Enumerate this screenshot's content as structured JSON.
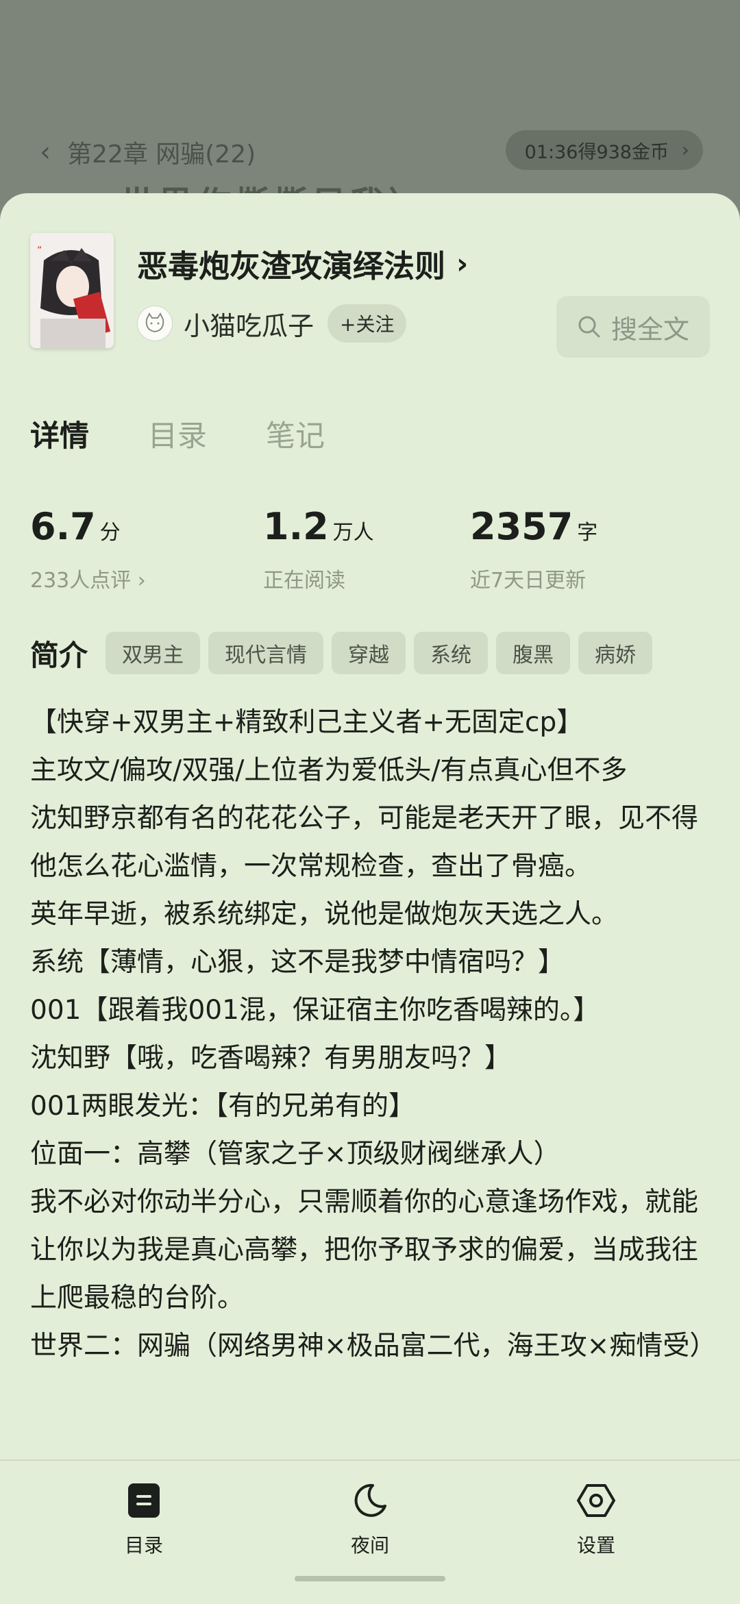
{
  "reader": {
    "chapter_title": "第22章 网骗(22)",
    "coin_pill": "01:36得938金币",
    "ghost_text": "世界作撕撕风我〉"
  },
  "book": {
    "title": "恶毒炮灰渣攻演绎法则",
    "author": "小猫吃瓜子",
    "follow_label": "+关注",
    "search_label": "搜全文"
  },
  "tabs": [
    "详情",
    "目录",
    "笔记"
  ],
  "stats": [
    {
      "num": "6.7",
      "unit": "分",
      "sub": "233人点评 ›"
    },
    {
      "num": "1.2",
      "unit": "万人",
      "sub": "正在阅读"
    },
    {
      "num": "2357",
      "unit": "字",
      "sub": "近7天日更新"
    }
  ],
  "intro": {
    "label": "简介",
    "tags": [
      "双男主",
      "现代言情",
      "穿越",
      "系统",
      "腹黑",
      "病娇"
    ],
    "paragraphs": [
      "【快穿+双男主+精致利己主义者+无固定cp】",
      "主攻文/偏攻/双强/上位者为爱低头/有点真心但不多",
      "沈知野京都有名的花花公子，可能是老天开了眼，见不得他怎么花心滥情，一次常规检查，查出了骨癌。",
      "英年早逝，被系统绑定，说他是做炮灰天选之人。",
      "系统【薄情，心狠，这不是我梦中情宿吗？】",
      "001【跟着我001混，保证宿主你吃香喝辣的。】",
      "沈知野【哦，吃香喝辣？有男朋友吗？】",
      "001两眼发光：【有的兄弟有的】",
      "位面一：高攀（管家之子×顶级财阀继承人）",
      "我不必对你动半分心，只需顺着你的心意逢场作戏，就能让你以为我是真心高攀，把你予取予求的偏爱，当成我往上爬最稳的台阶。",
      "世界二：网骗（网络男神×极品富二代，海王攻×痴情受）"
    ]
  },
  "bottom_nav": {
    "catalog": "目录",
    "night": "夜间",
    "settings": "设置"
  },
  "colors": {
    "sheet_bg": "#e2eed7",
    "tag_bg": "#d1dcc7",
    "muted_text": "#8f9888"
  }
}
